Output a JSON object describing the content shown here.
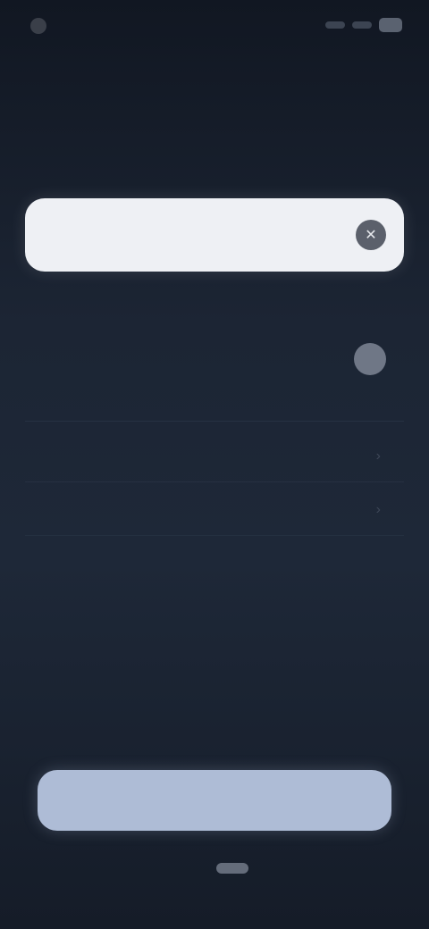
{
  "status_bar": {
    "time": "",
    "icons": [
      "signal-icon",
      "wifi-icon",
      "battery-icon"
    ]
  },
  "header": {
    "title": ""
  },
  "search": {
    "value": "",
    "placeholder": "",
    "clear_icon": "clear-icon"
  },
  "section": {
    "label": ""
  },
  "list": {
    "items": [
      {
        "title": "",
        "subtitle": "",
        "control": "toggle"
      },
      {
        "title": "",
        "control": "chevron"
      },
      {
        "title": "",
        "control": "chevron"
      }
    ]
  },
  "footer": {
    "primary_label": ""
  },
  "colors": {
    "background": "#1c2534",
    "search_background": "#eef0f4",
    "primary_button": "#aebcd6"
  }
}
